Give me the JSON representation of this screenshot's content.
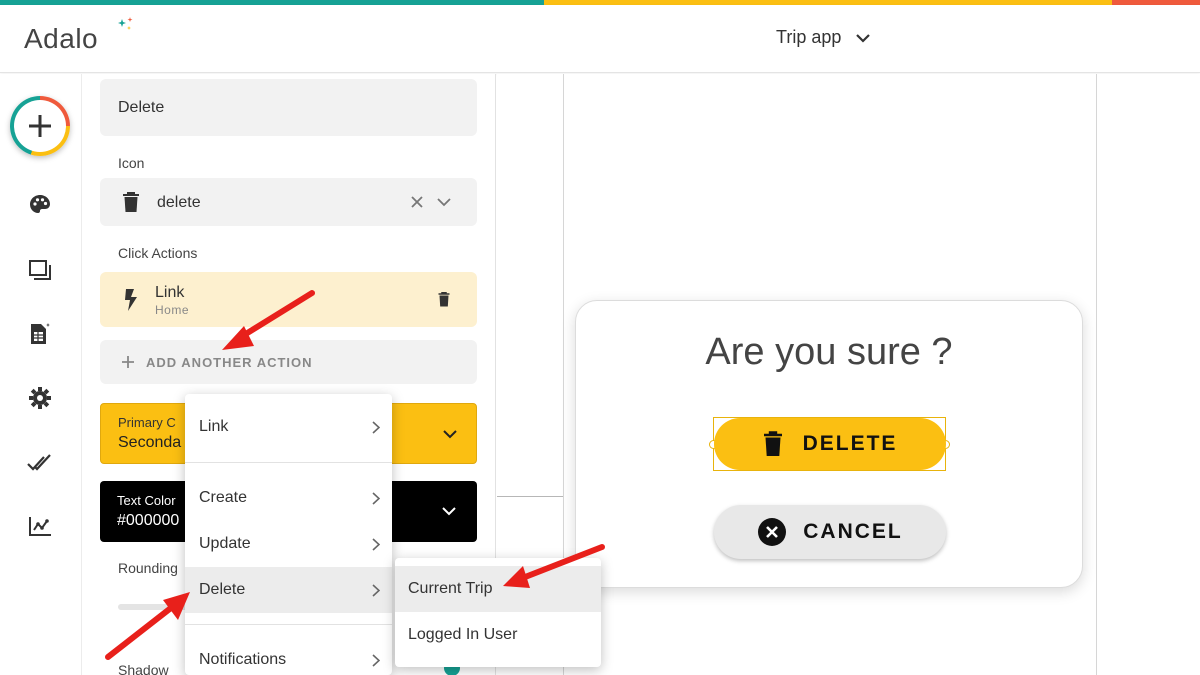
{
  "header": {
    "logo": "Adalo",
    "app_name": "Trip app"
  },
  "colors": {
    "teal": "#16a295",
    "yellow": "#fbbf12",
    "red": "#ef5a3c",
    "arrow": "#e8201b"
  },
  "rail": {
    "icons": [
      "add-icon",
      "palette-icon",
      "screens-icon",
      "database-icon",
      "gear-icon",
      "publish-icon",
      "analytics-icon"
    ]
  },
  "panel": {
    "text_value": "Delete",
    "icon_label": "Icon",
    "icon_value": "delete",
    "click_actions_label": "Click Actions",
    "action": {
      "title": "Link",
      "subtitle": "Home"
    },
    "add_action_label": "ADD ANOTHER ACTION",
    "primary_color_label": "Primary C",
    "primary_color_value": "Seconda",
    "text_color_label": "Text Color",
    "text_color_value": "#000000",
    "rounding_label": "Rounding",
    "shadow_label": "Shadow"
  },
  "menu": {
    "items": [
      "Link",
      "Create",
      "Update",
      "Delete",
      "Notifications"
    ]
  },
  "submenu": {
    "items": [
      "Current Trip",
      "Logged In User"
    ]
  },
  "modal": {
    "title": "Are you sure ?",
    "delete_label": "DELETE",
    "cancel_label": "CANCEL"
  }
}
